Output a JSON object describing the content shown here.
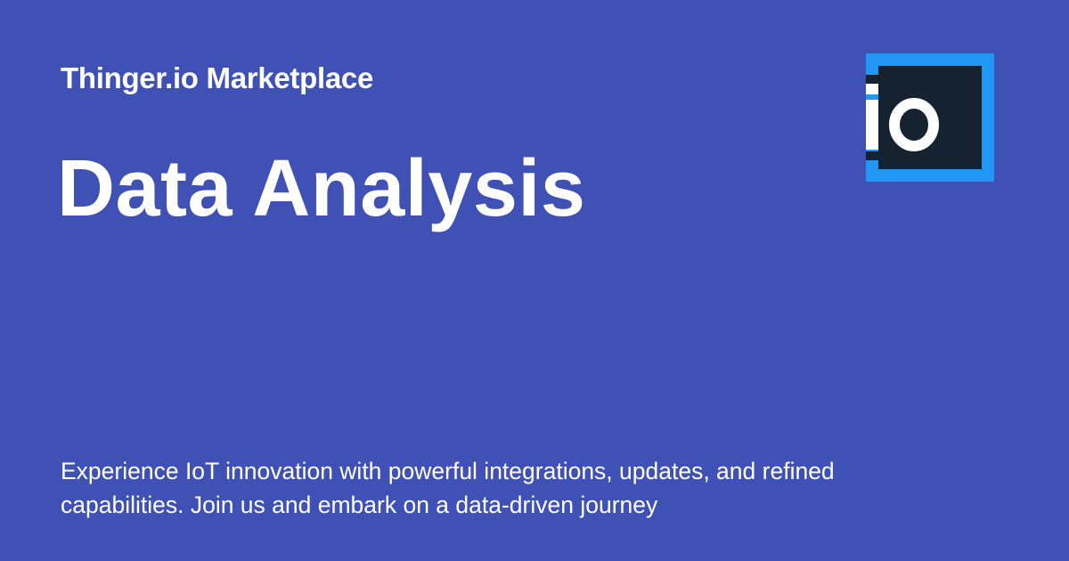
{
  "header": {
    "site_name": "Thinger.io Marketplace"
  },
  "main": {
    "title": "Data Analysis",
    "description": "Experience IoT innovation with powerful integrations, updates, and refined capabilities. Join us and embark on a data-driven journey"
  },
  "logo": {
    "icon": "thinger-io-logo",
    "text": "io"
  },
  "colors": {
    "background": "#3f51b5",
    "text": "#ffffff",
    "logo_border": "#2196f3",
    "logo_fill": "#14232f"
  }
}
